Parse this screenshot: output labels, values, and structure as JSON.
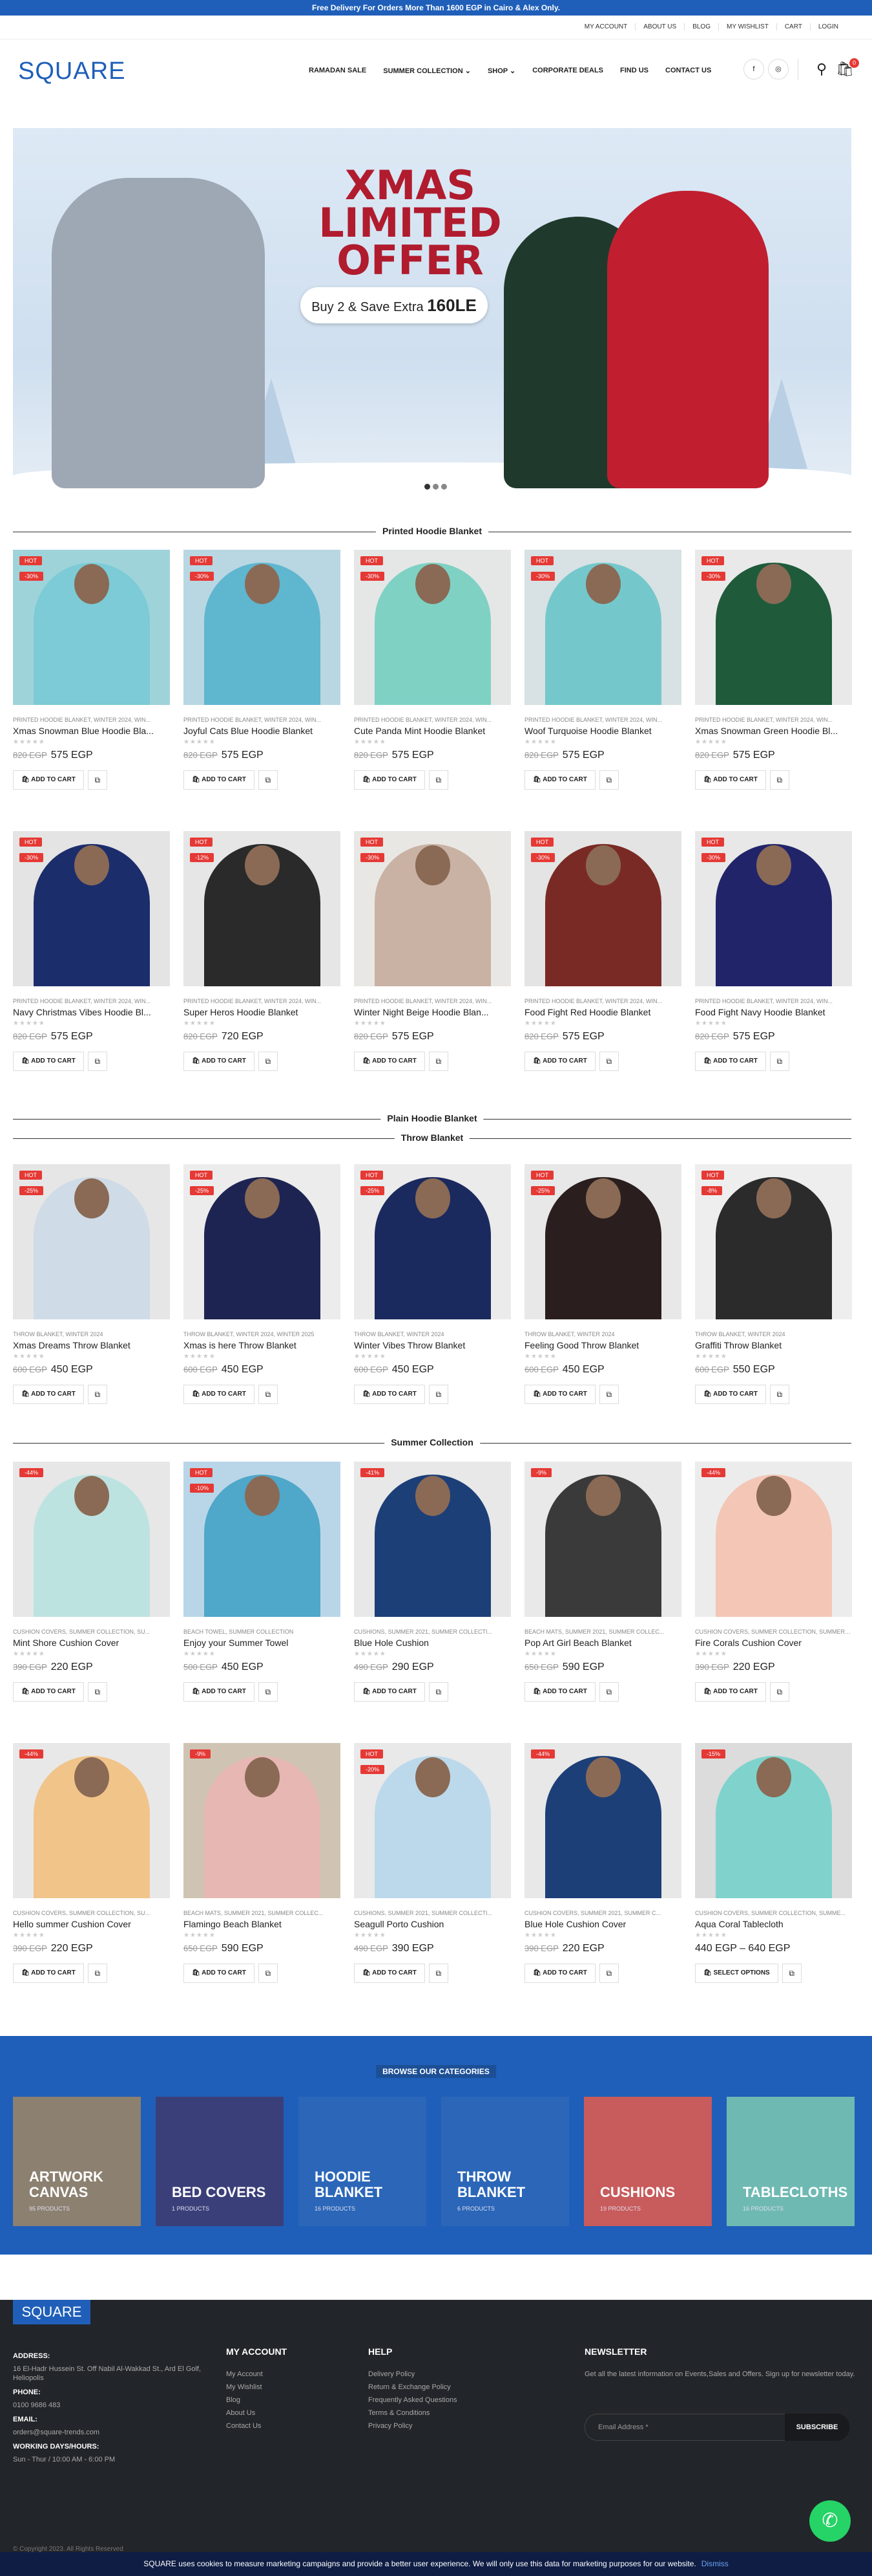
{
  "topbar": {
    "text": "Free Delivery For Orders More Than 1600 EGP in Cairo & Alex Only."
  },
  "util_links": [
    "MY ACCOUNT",
    "ABOUT US",
    "BLOG",
    "MY WISHLIST",
    "CART",
    "LOGIN"
  ],
  "logo": "SQUARE",
  "nav": [
    "RAMADAN SALE",
    "SUMMER COLLECTION ⌄",
    "SHOP ⌄",
    "CORPORATE DEALS",
    "FIND US",
    "CONTACT US"
  ],
  "header_icons": {
    "facebook": "f",
    "instagram": "◎",
    "search": "⚲",
    "cart": "🛍",
    "cart_count": "0"
  },
  "hero": {
    "title": "XMAS LIMITED OFFER",
    "sub": "Buy 2 & Save Extra",
    "amount": "160LE"
  },
  "sections": {
    "printed": "Printed Hoodie Blanket",
    "plain": "Plain Hoodie Blanket",
    "throw": "Throw Blanket",
    "summer": "Summer Collection"
  },
  "labels": {
    "add": "ADD TO CART",
    "select": "SELECT OPTIONS"
  },
  "printed_row1": [
    {
      "cat": "PRINTED HOODIE BLANKET, WINTER 2024, WIN...",
      "name": "Xmas Snowman Blue Hoodie Bla...",
      "old": "820 EGP",
      "price": "575 EGP",
      "b1": "HOT",
      "b2": "-30%",
      "bg": "#9fd3da",
      "fig": "#7ccbd6"
    },
    {
      "cat": "PRINTED HOODIE BLANKET, WINTER 2024, WIN...",
      "name": "Joyful Cats Blue Hoodie Blanket",
      "old": "820 EGP",
      "price": "575 EGP",
      "b1": "HOT",
      "b2": "-30%",
      "bg": "#b8d7e2",
      "fig": "#5fb6cf"
    },
    {
      "cat": "PRINTED HOODIE BLANKET, WINTER 2024, WIN...",
      "name": "Cute Panda Mint Hoodie Blanket",
      "old": "820 EGP",
      "price": "575 EGP",
      "b1": "HOT",
      "b2": "-30%",
      "bg": "#e5e7e6",
      "fig": "#7fd1c4"
    },
    {
      "cat": "PRINTED HOODIE BLANKET, WINTER 2024, WIN...",
      "name": "Woof Turquoise Hoodie Blanket",
      "old": "820 EGP",
      "price": "575 EGP",
      "b1": "HOT",
      "b2": "-30%",
      "bg": "#d8e1e3",
      "fig": "#74c8cc"
    },
    {
      "cat": "PRINTED HOODIE BLANKET, WINTER 2024, WIN...",
      "name": "Xmas Snowman Green Hoodie Bl...",
      "old": "820 EGP",
      "price": "575 EGP",
      "b1": "HOT",
      "b2": "-30%",
      "bg": "#e9e9e9",
      "fig": "#1f5b3a"
    }
  ],
  "printed_row2": [
    {
      "cat": "PRINTED HOODIE BLANKET, WINTER 2024, WIN...",
      "name": "Navy Christmas Vibes Hoodie Bl...",
      "old": "820 EGP",
      "price": "575 EGP",
      "b1": "HOT",
      "b2": "-30%",
      "bg": "#e4e4e4",
      "fig": "#1c2d6b"
    },
    {
      "cat": "PRINTED HOODIE BLANKET, WINTER 2024, WIN...",
      "name": "Super Heros Hoodie Blanket",
      "old": "820 EGP",
      "price": "720 EGP",
      "b1": "HOT",
      "b2": "-12%",
      "bg": "#e6e6e6",
      "fig": "#2a2a2a"
    },
    {
      "cat": "PRINTED HOODIE BLANKET, WINTER 2024, WIN...",
      "name": "Winter Night Beige Hoodie Blan...",
      "old": "820 EGP",
      "price": "575 EGP",
      "b1": "HOT",
      "b2": "-30%",
      "bg": "#e9e7e4",
      "fig": "#c9b2a3"
    },
    {
      "cat": "PRINTED HOODIE BLANKET, WINTER 2024, WIN...",
      "name": "Food Fight Red Hoodie Blanket",
      "old": "820 EGP",
      "price": "575 EGP",
      "b1": "HOT",
      "b2": "-30%",
      "bg": "#e4e4e4",
      "fig": "#7a2a24"
    },
    {
      "cat": "PRINTED HOODIE BLANKET, WINTER 2024, WIN...",
      "name": "Food Fight Navy Hoodie Blanket",
      "old": "820 EGP",
      "price": "575 EGP",
      "b1": "HOT",
      "b2": "-30%",
      "bg": "#e8e8e8",
      "fig": "#22246a"
    }
  ],
  "throw_row": [
    {
      "cat": "THROW BLANKET, WINTER 2024",
      "name": "Xmas Dreams Throw Blanket",
      "old": "600 EGP",
      "price": "450 EGP",
      "b1": "HOT",
      "b2": "-25%",
      "bg": "#e6e6e6",
      "fig": "#cfdbe6"
    },
    {
      "cat": "THROW BLANKET, WINTER 2024, WINTER 2025",
      "name": "Xmas is here Throw Blanket",
      "old": "600 EGP",
      "price": "450 EGP",
      "b1": "HOT",
      "b2": "-25%",
      "bg": "#ececec",
      "fig": "#1e2452"
    },
    {
      "cat": "THROW BLANKET, WINTER 2024",
      "name": "Winter Vibes Throw Blanket",
      "old": "600 EGP",
      "price": "450 EGP",
      "b1": "HOT",
      "b2": "-25%",
      "bg": "#ebebeb",
      "fig": "#1b2a5e"
    },
    {
      "cat": "THROW BLANKET, WINTER 2024",
      "name": "Feeling Good Throw Blanket",
      "old": "600 EGP",
      "price": "450 EGP",
      "b1": "HOT",
      "b2": "-25%",
      "bg": "#e8e8e8",
      "fig": "#2a1f1e"
    },
    {
      "cat": "THROW BLANKET, WINTER 2024",
      "name": "Graffiti Throw Blanket",
      "old": "600 EGP",
      "price": "550 EGP",
      "b1": "HOT",
      "b2": "-8%",
      "bg": "#eeeeee",
      "fig": "#2b2b2b"
    }
  ],
  "summer_row1": [
    {
      "cat": "CUSHION COVERS, SUMMER COLLECTION, SU...",
      "name": "Mint Shore Cushion Cover",
      "old": "390 EGP",
      "price": "220 EGP",
      "b1": "-44%",
      "b2": "",
      "bg": "#e7e7e7",
      "fig": "#bde3e1"
    },
    {
      "cat": "BEACH TOWEL, SUMMER COLLECTION",
      "name": "Enjoy your Summer Towel",
      "old": "500 EGP",
      "price": "450 EGP",
      "b1": "HOT",
      "b2": "-10%",
      "bg": "#b9d6e8",
      "fig": "#4fa7c9"
    },
    {
      "cat": "CUSHIONS, SUMMER 2021, SUMMER COLLECTI...",
      "name": "Blue Hole Cushion",
      "old": "490 EGP",
      "price": "290 EGP",
      "b1": "-41%",
      "b2": "",
      "bg": "#e8e8e8",
      "fig": "#1d3f78"
    },
    {
      "cat": "BEACH MATS, SUMMER 2021, SUMMER COLLEC...",
      "name": "Pop Art Girl Beach Blanket",
      "old": "650 EGP",
      "price": "590 EGP",
      "b1": "-9%",
      "b2": "",
      "bg": "#e9e9e9",
      "fig": "#3a3a3a"
    },
    {
      "cat": "CUSHION COVERS, SUMMER COLLECTION, SUMMER C...",
      "name": "Fire Corals Cushion Cover",
      "old": "390 EGP",
      "price": "220 EGP",
      "b1": "-44%",
      "b2": "",
      "bg": "#ececec",
      "fig": "#f3c6b6"
    }
  ],
  "summer_row2": [
    {
      "cat": "CUSHION COVERS, SUMMER COLLECTION, SU...",
      "name": "Hello summer Cushion Cover",
      "old": "390 EGP",
      "price": "220 EGP",
      "b1": "-44%",
      "b2": "",
      "bg": "#e8e8e8",
      "fig": "#f1c48a"
    },
    {
      "cat": "BEACH MATS, SUMMER 2021, SUMMER COLLEC...",
      "name": "Flamingo Beach Blanket",
      "old": "650 EGP",
      "price": "590 EGP",
      "b1": "-9%",
      "b2": "",
      "bg": "#cfc4b4",
      "fig": "#e7b7b4"
    },
    {
      "cat": "CUSHIONS, SUMMER 2021, SUMMER COLLECTI...",
      "name": "Seagull Porto Cushion",
      "old": "490 EGP",
      "price": "390 EGP",
      "b1": "HOT",
      "b2": "-20%",
      "bg": "#e9e9e9",
      "fig": "#bcd9ec"
    },
    {
      "cat": "CUSHION COVERS, SUMMER 2021, SUMMER C...",
      "name": "Blue Hole Cushion Cover",
      "old": "390 EGP",
      "price": "220 EGP",
      "b1": "-44%",
      "b2": "",
      "bg": "#e8e8e8",
      "fig": "#1d3f78"
    },
    {
      "cat": "CUSHION COVERS, SUMMER COLLECTION, SUMME...",
      "name": "Aqua Coral Tablecloth",
      "old": "",
      "price": "440 EGP – 640 EGP",
      "b1": "-15%",
      "b2": "",
      "bg": "#dcdcdc",
      "fig": "#7fd3cc",
      "select": true
    }
  ],
  "categories_title": "BROWSE OUR CATEGORIES",
  "categories": [
    {
      "name": "ARTWORK CANVAS",
      "count": "95 PRODUCTS",
      "bg": "#8c8070"
    },
    {
      "name": "BED COVERS",
      "count": "1 PRODUCTS",
      "bg": "#3b3f79"
    },
    {
      "name": "HOODIE BLANKET",
      "count": "16 PRODUCTS",
      "bg": "#2b66b8"
    },
    {
      "name": "THROW BLANKET",
      "count": "6 PRODUCTS",
      "bg": "#2b66b8"
    },
    {
      "name": "CUSHIONS",
      "count": "19 PRODUCTS",
      "bg": "#c85b5b"
    },
    {
      "name": "TABLECLOTHS",
      "count": "16 PRODUCTS",
      "bg": "#6fb9b3"
    }
  ],
  "footer": {
    "logo": "SQUARE",
    "address_label": "ADDRESS:",
    "address": "16 El-Hadr Hussein St. Off Nabil Al-Wakkad St., Ard El Golf, Heliopolis",
    "phone_label": "PHONE:",
    "phone": "0100 9686 483",
    "email_label": "EMAIL:",
    "email": "orders@square-trends.com",
    "hours_label": "WORKING DAYS/HOURS:",
    "hours": "Sun - Thur / 10:00 AM - 6:00 PM",
    "account_title": "MY ACCOUNT",
    "account_links": [
      "My Account",
      "My Wishlist",
      "Blog",
      "About Us",
      "Contact Us"
    ],
    "help_title": "HELP",
    "help_links": [
      "Delivery Policy",
      "Return & Exchange Policy",
      "Frequently Asked Questions",
      "Terms & Conditions",
      "Privacy Policy"
    ],
    "news_title": "NEWSLETTER",
    "news_text": "Get all the latest information on Events,Sales and Offers. Sign up for newsletter today.",
    "email_placeholder": "Email Address *",
    "subscribe": "SUBSCRIBE",
    "copyright": "© Copyright 2023. All Rights Reserved"
  },
  "cookie": {
    "text": "SQUARE uses cookies to measure marketing campaigns and provide a better user experience. We will only use this data for marketing purposes for our website.",
    "dismiss": "Dismiss"
  },
  "whatsapp": "✆"
}
